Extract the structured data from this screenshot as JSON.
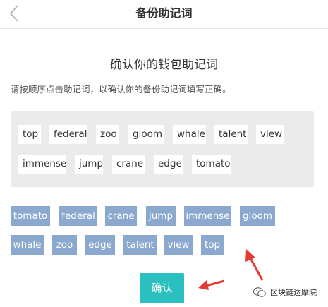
{
  "header": {
    "title": "备份助记词",
    "back_icon": "chevron-left-icon"
  },
  "main": {
    "title": "确认你的钱包助记词",
    "instruction": "请按顺序点击助记词，以确认你的备份助记词填写正确。"
  },
  "pool": {
    "words": [
      "top",
      "federal",
      "zoo",
      "gloom",
      "whale",
      "talent",
      "view",
      "immense",
      "jump",
      "crane",
      "edge",
      "tomato"
    ]
  },
  "selected": {
    "words": [
      "tomato",
      "federal",
      "crane",
      "jump",
      "immense",
      "gloom",
      "whale",
      "zoo",
      "edge",
      "talent",
      "view",
      "top"
    ]
  },
  "confirm_label": "确认",
  "watermark": {
    "text": "区块链达摩院",
    "icon": "wechat-icon"
  },
  "colors": {
    "chip_bg": "#8ba9cf",
    "confirm_bg": "#2bbfc0",
    "pool_bg": "#ebebeb",
    "arrow": "#e53935"
  }
}
